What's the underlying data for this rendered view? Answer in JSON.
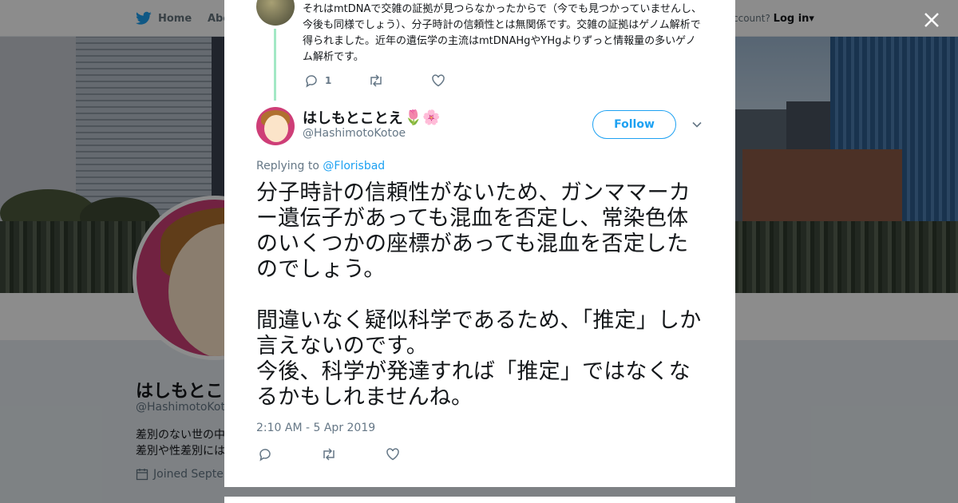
{
  "topbar": {
    "home_label": "Home",
    "about_label": "Abo",
    "account_prompt": "ccount?",
    "login_label": "Log in"
  },
  "profile": {
    "name": "はしもとこ",
    "handle": "@HashimotoKotoe",
    "bio_line1": "差別のない世の中",
    "bio_line2": "差別や性差別には",
    "joined": "Joined Septen"
  },
  "modal": {
    "close_label": "×",
    "previous_tweet": {
      "text": "それはmtDNAで交雑の証拠が見つらなかったからで（今でも見つかっていませんし、今後も同様でしょう）、分子時計の信頼性とは無関係です。交雑の証拠はゲノム解析で得られました。近年の遺伝学の主流はmtDNAHgやYHgよりずっと情報量の多いゲノム解析です。",
      "reply_count": "1",
      "retweet_count": "",
      "like_count": ""
    },
    "tweet": {
      "display_name": "はしもとことえ",
      "name_emojis": "🌷🌸",
      "handle": "@HashimotoKotoe",
      "follow_label": "Follow",
      "replying_prefix": "Replying to ",
      "replying_to": "@Florisbad",
      "text": "分子時計の信頼性がないため、ガンママーカー遺伝子があっても混血を否定し、常染色体のいくつかの座標があっても混血を否定したのでしょう。\n\n間違いなく疑似科学であるため、「推定」しか言えないのです。\n今後、科学が発達すれば「推定」ではなくなるかもしれませんね。",
      "timestamp": "2:10 AM - 5 Apr 2019"
    }
  },
  "colors": {
    "accent": "#1da1f2",
    "thread_line": "#a3e8c5",
    "text_primary": "#14171a",
    "text_secondary": "#657786",
    "avatar_bg": "#ce3e77"
  },
  "icons": {
    "brand": "twitter-bird-icon",
    "reply": "reply-icon",
    "retweet": "retweet-icon",
    "like": "heart-icon",
    "close": "close-icon",
    "chevron": "chevron-down-icon",
    "calendar": "calendar-icon"
  }
}
